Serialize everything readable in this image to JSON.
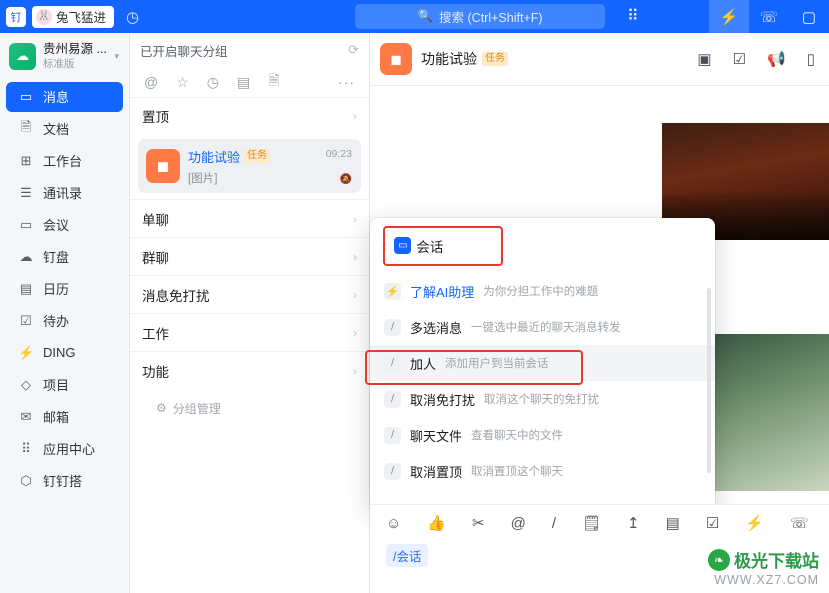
{
  "titlebar": {
    "app_badge": "钉",
    "rabbit_label": "兔飞猛进",
    "rabbit_icon": "rabbit-icon",
    "history_icon": "history-icon",
    "search_placeholder": "搜索 (Ctrl+Shift+F)",
    "search_icon": "search-icon",
    "apps_icon": "grid-apps-icon",
    "right_buttons": [
      {
        "name": "lightning-icon",
        "glyph": "⚡"
      },
      {
        "name": "phone-icon",
        "glyph": "☏"
      },
      {
        "name": "window-icon",
        "glyph": "▢"
      }
    ]
  },
  "sidebar": {
    "org": {
      "name": "贵州易源 ...",
      "sub": "标准版",
      "logo_glyph": "☁",
      "caret": "▾"
    },
    "items": [
      {
        "label": "消息",
        "icon": "message-icon",
        "glyph": "▭",
        "active": true
      },
      {
        "label": "文档",
        "icon": "document-icon",
        "glyph": "🗎",
        "active": false
      },
      {
        "label": "工作台",
        "icon": "workbench-icon",
        "glyph": "⊞",
        "active": false
      },
      {
        "label": "通讯录",
        "icon": "contacts-icon",
        "glyph": "☰",
        "active": false
      },
      {
        "label": "会议",
        "icon": "meeting-icon",
        "glyph": "▭",
        "active": false
      },
      {
        "label": "钉盘",
        "icon": "drive-icon",
        "glyph": "☁",
        "active": false
      },
      {
        "label": "日历",
        "icon": "calendar-icon",
        "glyph": "▤",
        "active": false
      },
      {
        "label": "待办",
        "icon": "todo-icon",
        "glyph": "☑",
        "active": false
      },
      {
        "label": "DING",
        "icon": "ding-icon",
        "glyph": "⚡",
        "active": false
      },
      {
        "label": "项目",
        "icon": "project-icon",
        "glyph": "◇",
        "active": false
      },
      {
        "label": "邮箱",
        "icon": "mail-icon",
        "glyph": "✉",
        "active": false
      },
      {
        "label": "应用中心",
        "icon": "app-center-icon",
        "glyph": "⠿",
        "active": false
      },
      {
        "label": "钉钉搭",
        "icon": "lowcode-icon",
        "glyph": "⬡",
        "active": false
      }
    ]
  },
  "chatlist": {
    "header": "已开启聊天分组",
    "refresh_icon": "refresh-icon",
    "tools": [
      {
        "name": "at-icon",
        "glyph": "@"
      },
      {
        "name": "star-icon",
        "glyph": "☆"
      },
      {
        "name": "clock-icon",
        "glyph": "◷"
      },
      {
        "name": "archive-icon",
        "glyph": "▤"
      },
      {
        "name": "doc-icon",
        "glyph": "🗎"
      },
      {
        "name": "more-icon",
        "glyph": "···"
      }
    ],
    "pinned_row": {
      "label": "置顶",
      "chevron": "›"
    },
    "conversation": {
      "avatar_glyph": "◼",
      "title": "功能试验",
      "tag": "任务",
      "time": "09:23",
      "preview": "[图片]",
      "mute_icon": "mute-icon",
      "mute_glyph": "🔕"
    },
    "groups": [
      {
        "label": "单聊",
        "chevron": "›"
      },
      {
        "label": "群聊",
        "chevron": "›"
      },
      {
        "label": "消息免打扰",
        "chevron": "›"
      },
      {
        "label": "工作",
        "chevron": "›"
      },
      {
        "label": "功能",
        "chevron": "›"
      }
    ],
    "manage": {
      "label": "分组管理",
      "icon": "settings-icon",
      "glyph": "⚙"
    }
  },
  "chatpane": {
    "avatar_glyph": "◼",
    "title": "功能试验",
    "tag": "任务",
    "actions": [
      {
        "name": "video-icon",
        "glyph": "▣"
      },
      {
        "name": "task-icon",
        "glyph": "☑"
      },
      {
        "name": "announce-icon",
        "glyph": "📢"
      },
      {
        "name": "panel-icon",
        "glyph": "▯"
      }
    ]
  },
  "slash_popup": {
    "back_icon": "back-chevron-icon",
    "chip_label": "会话",
    "chip_icon": "conversation-icon",
    "items": [
      {
        "slash": "⚡",
        "name": "了解AI助理",
        "desc": "为你分担工作中的难题",
        "highlight": true,
        "selected": false
      },
      {
        "slash": "/",
        "name": "多选消息",
        "desc": "一键选中最近的聊天消息转发",
        "highlight": false,
        "selected": false
      },
      {
        "slash": "/",
        "name": "加人",
        "desc": "添加用户到当前会话",
        "highlight": false,
        "selected": true
      },
      {
        "slash": "/",
        "name": "取消免打扰",
        "desc": "取消这个聊天的免打扰",
        "highlight": false,
        "selected": false
      },
      {
        "slash": "/",
        "name": "聊天文件",
        "desc": "查看聊天中的文件",
        "highlight": false,
        "selected": false
      },
      {
        "slash": "/",
        "name": "取消置顶",
        "desc": "取消置顶这个聊天",
        "highlight": false,
        "selected": false
      }
    ]
  },
  "composer": {
    "tools": [
      {
        "name": "emoji-icon",
        "glyph": "☺"
      },
      {
        "name": "thumbsup-icon",
        "glyph": "👍"
      },
      {
        "name": "scissors-icon",
        "glyph": "✂"
      },
      {
        "name": "at-icon",
        "glyph": "@"
      },
      {
        "name": "slash-icon",
        "glyph": "/"
      },
      {
        "name": "note-icon",
        "glyph": "🗒"
      },
      {
        "name": "upload-icon",
        "glyph": "↥"
      },
      {
        "name": "card-icon",
        "glyph": "▤"
      },
      {
        "name": "todo-icon",
        "glyph": "☑"
      },
      {
        "name": "ding-icon",
        "glyph": "⚡"
      },
      {
        "name": "call-icon",
        "glyph": "☏"
      }
    ],
    "input_value": "/会话"
  },
  "watermark": {
    "title": "极光下载站",
    "domain": "WWW.XZ7.COM",
    "leaf_glyph": "❧"
  },
  "colors": {
    "brand": "#1464ff",
    "accent_red": "#e8392e",
    "tag_orange": "#e08b1a"
  }
}
